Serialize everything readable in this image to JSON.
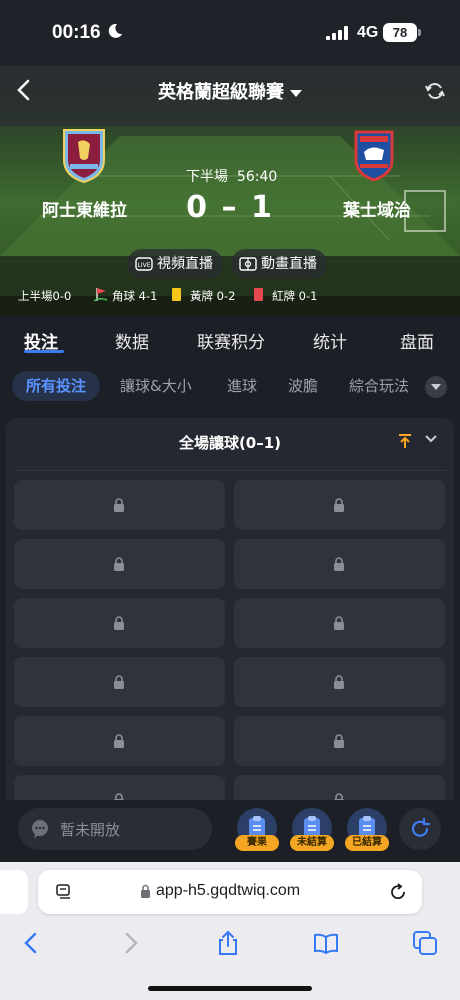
{
  "status_bar": {
    "time": "00:16",
    "network": "4G",
    "battery": "78"
  },
  "header": {
    "league_title": "英格蘭超級聯賽"
  },
  "match": {
    "home_team": "阿士東維拉",
    "away_team": "葉士域治",
    "period": "下半場",
    "clock": "56:40",
    "home_score": "0",
    "separator": "–",
    "away_score": "1",
    "live_video_label": "視頻直播",
    "animation_label": "動畫直播",
    "stats": {
      "first_half": "上半場0-0",
      "corners": "角球 4-1",
      "yellow_cards": "黃牌 0-2",
      "red_cards": "紅牌 0-1"
    }
  },
  "tabs": [
    "投注",
    "数据",
    "联赛积分",
    "统计",
    "盘面"
  ],
  "active_tab": "投注",
  "subtabs": [
    "所有投注",
    "讓球&大小",
    "進球",
    "波膽",
    "綜合玩法"
  ],
  "active_subtab": "所有投注",
  "market": {
    "title": "全場讓球(0–1)",
    "rows": 6,
    "columns": 2,
    "locked": true
  },
  "action_bar": {
    "input_placeholder": "暫未開放",
    "buttons": [
      "賽果",
      "未結算",
      "已結算"
    ]
  },
  "browser": {
    "url": "app-h5.gqdtwiq.com"
  },
  "colors": {
    "accent": "#3f7bf0",
    "badge": "#f5a623",
    "yellow_card": "#f5c518",
    "red_card": "#e5484d"
  }
}
